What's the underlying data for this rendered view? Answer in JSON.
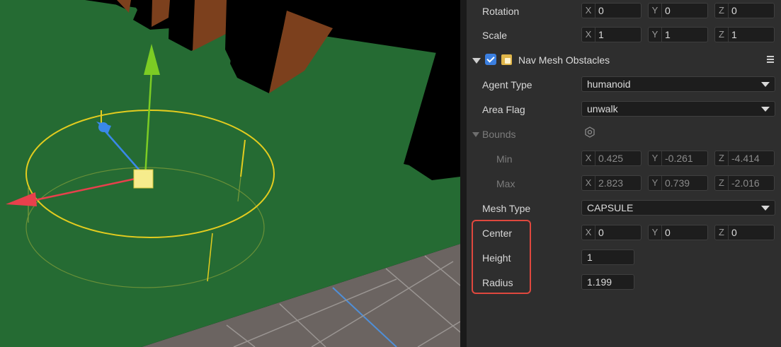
{
  "transform": {
    "rotation": {
      "label": "Rotation",
      "x": "0",
      "y": "0",
      "z": "0"
    },
    "scale": {
      "label": "Scale",
      "x": "1",
      "y": "1",
      "z": "1"
    }
  },
  "component": {
    "title": "Nav Mesh Obstacles",
    "enabled": true,
    "agent_type": {
      "label": "Agent Type",
      "value": "humanoid"
    },
    "area_flag": {
      "label": "Area Flag",
      "value": "unwalk"
    },
    "bounds": {
      "label": "Bounds",
      "min": {
        "label": "Min",
        "x": "0.425",
        "y": "-0.261",
        "z": "-4.414"
      },
      "max": {
        "label": "Max",
        "x": "2.823",
        "y": "0.739",
        "z": "-2.016"
      }
    },
    "mesh_type": {
      "label": "Mesh Type",
      "value": "CAPSULE"
    },
    "center": {
      "label": "Center",
      "x": "0",
      "y": "0",
      "z": "0"
    },
    "height": {
      "label": "Height",
      "value": "1"
    },
    "radius": {
      "label": "Radius",
      "value": "1.199"
    }
  },
  "axes": {
    "x": "X",
    "y": "Y",
    "z": "Z"
  },
  "colors": {
    "ground": "#256b33",
    "floor": "#6b6461",
    "highlight": "#e0483e",
    "gizmo_yellow": "#e3cc1f",
    "axis_x": "#e8404c",
    "axis_y": "#7ccc24",
    "axis_z": "#3a88e8",
    "checkbox": "#3b7fe0"
  }
}
